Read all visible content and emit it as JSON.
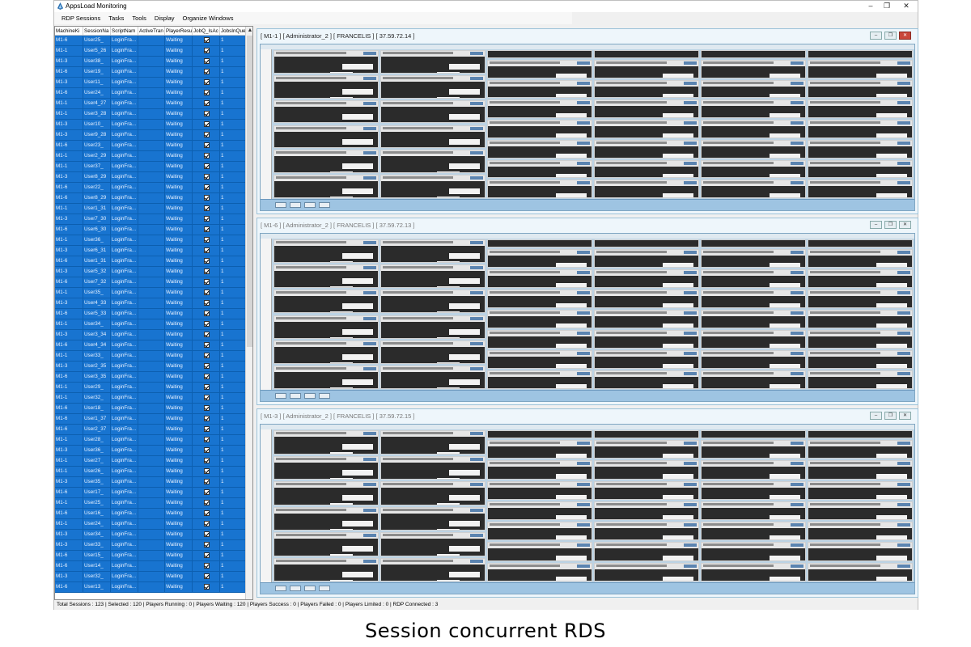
{
  "window": {
    "title": "AppsLoad Monitoring",
    "controls": [
      "–",
      "❐",
      "✕"
    ]
  },
  "menu": [
    "RDP Sessions",
    "Tasks",
    "Tools",
    "Display",
    "Organize Windows"
  ],
  "grid": {
    "columns": [
      "MachineKi",
      "SessionNa",
      "ScriptNam",
      "ActiveTran",
      "PlayerResu",
      "JobQ_IsAc",
      "JobsInQue"
    ],
    "rows": [
      [
        "M1-6",
        "User25_",
        "LoginFra...",
        "",
        "Waiting",
        "1"
      ],
      [
        "M1-1",
        "User5_26",
        "LoginFra...",
        "",
        "Waiting",
        "1"
      ],
      [
        "M1-3",
        "User38_",
        "LoginFra...",
        "",
        "Waiting",
        "1"
      ],
      [
        "M1-6",
        "User19_",
        "LoginFra...",
        "",
        "Waiting",
        "1"
      ],
      [
        "M1-3",
        "User11_",
        "LoginFra...",
        "",
        "Waiting",
        "1"
      ],
      [
        "M1-6",
        "User24_",
        "LoginFra...",
        "",
        "Waiting",
        "1"
      ],
      [
        "M1-1",
        "User4_27",
        "LoginFra...",
        "",
        "Waiting",
        "1"
      ],
      [
        "M1-1",
        "User3_28",
        "LoginFra...",
        "",
        "Waiting",
        "1"
      ],
      [
        "M1-3",
        "User10_",
        "LoginFra...",
        "",
        "Waiting",
        "1"
      ],
      [
        "M1-3",
        "User9_28",
        "LoginFra...",
        "",
        "Waiting",
        "1"
      ],
      [
        "M1-6",
        "User23_",
        "LoginFra...",
        "",
        "Waiting",
        "1"
      ],
      [
        "M1-1",
        "User2_29",
        "LoginFra...",
        "",
        "Waiting",
        "1"
      ],
      [
        "M1-1",
        "User37_",
        "LoginFra...",
        "",
        "Waiting",
        "1"
      ],
      [
        "M1-3",
        "User8_29",
        "LoginFra...",
        "",
        "Waiting",
        "1"
      ],
      [
        "M1-6",
        "User22_",
        "LoginFra...",
        "",
        "Waiting",
        "1"
      ],
      [
        "M1-6",
        "User8_29",
        "LoginFra...",
        "",
        "Waiting",
        "1"
      ],
      [
        "M1-1",
        "User1_31",
        "LoginFra...",
        "",
        "Waiting",
        "1"
      ],
      [
        "M1-3",
        "User7_30",
        "LoginFra...",
        "",
        "Waiting",
        "1"
      ],
      [
        "M1-6",
        "User6_30",
        "LoginFra...",
        "",
        "Waiting",
        "1"
      ],
      [
        "M1-1",
        "User36_",
        "LoginFra...",
        "",
        "Waiting",
        "1"
      ],
      [
        "M1-3",
        "User6_31",
        "LoginFra...",
        "",
        "Waiting",
        "1"
      ],
      [
        "M1-6",
        "User1_31",
        "LoginFra...",
        "",
        "Waiting",
        "1"
      ],
      [
        "M1-3",
        "User5_32",
        "LoginFra...",
        "",
        "Waiting",
        "1"
      ],
      [
        "M1-6",
        "User7_32",
        "LoginFra...",
        "",
        "Waiting",
        "1"
      ],
      [
        "M1-1",
        "User35_",
        "LoginFra...",
        "",
        "Waiting",
        "1"
      ],
      [
        "M1-3",
        "User4_33",
        "LoginFra...",
        "",
        "Waiting",
        "1"
      ],
      [
        "M1-6",
        "User5_33",
        "LoginFra...",
        "",
        "Waiting",
        "1"
      ],
      [
        "M1-1",
        "User34_",
        "LoginFra...",
        "",
        "Waiting",
        "1"
      ],
      [
        "M1-3",
        "User3_34",
        "LoginFra...",
        "",
        "Waiting",
        "1"
      ],
      [
        "M1-6",
        "User4_34",
        "LoginFra...",
        "",
        "Waiting",
        "1"
      ],
      [
        "M1-1",
        "User33_",
        "LoginFra...",
        "",
        "Waiting",
        "1"
      ],
      [
        "M1-3",
        "User2_35",
        "LoginFra...",
        "",
        "Waiting",
        "1"
      ],
      [
        "M1-6",
        "User3_35",
        "LoginFra...",
        "",
        "Waiting",
        "1"
      ],
      [
        "M1-1",
        "User29_",
        "LoginFra...",
        "",
        "Waiting",
        "1"
      ],
      [
        "M1-1",
        "User32_",
        "LoginFra...",
        "",
        "Waiting",
        "1"
      ],
      [
        "M1-6",
        "User18_",
        "LoginFra...",
        "",
        "Waiting",
        "1"
      ],
      [
        "M1-6",
        "User1_37",
        "LoginFra...",
        "",
        "Waiting",
        "1"
      ],
      [
        "M1-6",
        "User2_37",
        "LoginFra...",
        "",
        "Waiting",
        "1"
      ],
      [
        "M1-1",
        "User28_",
        "LoginFra...",
        "",
        "Waiting",
        "1"
      ],
      [
        "M1-3",
        "User36_",
        "LoginFra...",
        "",
        "Waiting",
        "1"
      ],
      [
        "M1-1",
        "User27_",
        "LoginFra...",
        "",
        "Waiting",
        "1"
      ],
      [
        "M1-1",
        "User26_",
        "LoginFra...",
        "",
        "Waiting",
        "1"
      ],
      [
        "M1-3",
        "User35_",
        "LoginFra...",
        "",
        "Waiting",
        "1"
      ],
      [
        "M1-6",
        "User17_",
        "LoginFra...",
        "",
        "Waiting",
        "1"
      ],
      [
        "M1-1",
        "User25_",
        "LoginFra...",
        "",
        "Waiting",
        "1"
      ],
      [
        "M1-6",
        "User16_",
        "LoginFra...",
        "",
        "Waiting",
        "1"
      ],
      [
        "M1-1",
        "User24_",
        "LoginFra...",
        "",
        "Waiting",
        "1"
      ],
      [
        "M1-3",
        "User34_",
        "LoginFra...",
        "",
        "Waiting",
        "1"
      ],
      [
        "M1-3",
        "User33_",
        "LoginFra...",
        "",
        "Waiting",
        "1"
      ],
      [
        "M1-6",
        "User15_",
        "LoginFra...",
        "",
        "Waiting",
        "1"
      ],
      [
        "M1-6",
        "User14_",
        "LoginFra...",
        "",
        "Waiting",
        "1"
      ],
      [
        "M1-3",
        "User32_",
        "LoginFra...",
        "",
        "Waiting",
        "1"
      ],
      [
        "M1-6",
        "User13_",
        "LoginFra...",
        "",
        "Waiting",
        "1"
      ]
    ]
  },
  "rdp_sessions": [
    {
      "title": "[ M1-1 ] [ Administrator_2 ] [ FRANCELIS ] [ 37.59.72.14 ]",
      "active": true
    },
    {
      "title": "[ M1-6 ] [ Administrator_2 ] [ FRANCELIS ] [ 37.59.72.13 ]",
      "active": false
    },
    {
      "title": "[ M1-3 ] [ Administrator_2 ] [ FRANCELIS ] [ 37.59.72.15 ]",
      "active": false
    }
  ],
  "status": "Total Sessions : 123  |  Selected : 120  |  Players Running : 0  |  Players Waiting : 120  |  Players Success : 0  |  Players Failed : 0  |  Players Limited : 0  |  RDP Connected : 3",
  "caption": "Session concurrent RDS",
  "colors": {
    "selection": "#1874d0",
    "close": "#c9473a"
  },
  "icons": {
    "app": "appsload-icon",
    "checkbox": "checkbox-checked-icon"
  }
}
